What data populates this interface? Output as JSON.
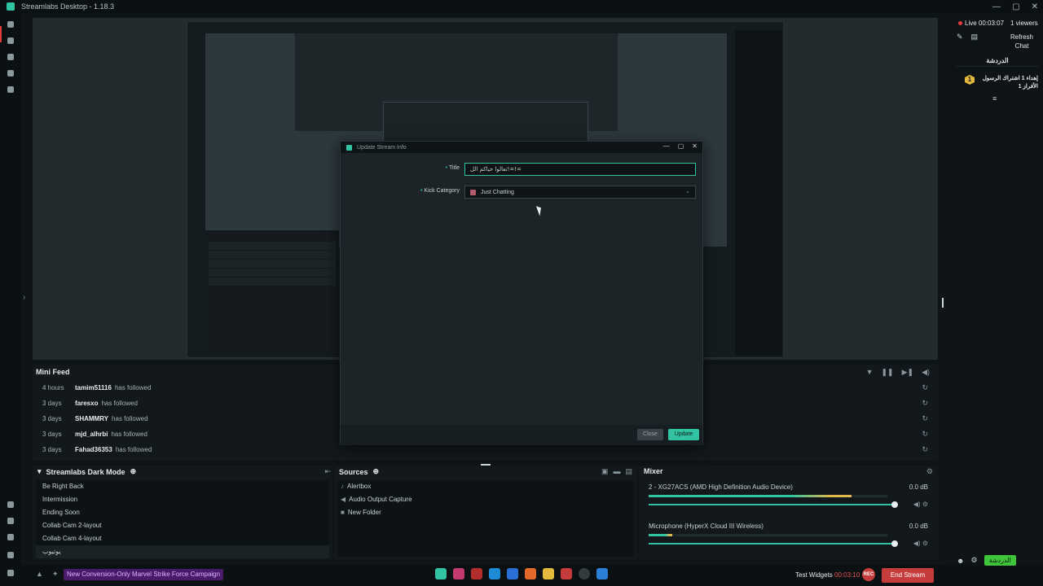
{
  "window": {
    "title": "Streamlabs Desktop - 1.18.3",
    "controls": [
      "—",
      "▢",
      "✕"
    ]
  },
  "minifeed": {
    "title": "Mini Feed",
    "rows": [
      {
        "time": "4 hours",
        "user": "tamim51116",
        "action": "has followed"
      },
      {
        "time": "3 days",
        "user": "faresxo",
        "action": "has followed"
      },
      {
        "time": "3 days",
        "user": "SHAMMRY",
        "action": "has followed"
      },
      {
        "time": "3 days",
        "user": "mjd_alhrbi",
        "action": "has followed"
      },
      {
        "time": "3 days",
        "user": "Fahad36353",
        "action": "has followed"
      }
    ]
  },
  "scenes": {
    "title": "Streamlabs Dark Mode",
    "items": [
      "Be Right Back",
      "Intermission",
      "Ending Soon",
      "Collab Cam 2-layout",
      "Collab Cam 4-layout",
      "يوتيوب"
    ],
    "active_index": 5
  },
  "sources": {
    "title": "Sources",
    "items": [
      {
        "label": "Alertbox",
        "icon": "bell-icon"
      },
      {
        "label": "Audio Output Capture",
        "icon": "speaker-icon"
      },
      {
        "label": "New Folder",
        "icon": "folder-icon"
      }
    ]
  },
  "mixer": {
    "title": "Mixer",
    "channels": [
      {
        "name": "2 - XG27ACS (AMD High Definition Audio Device)",
        "db": "0.0 dB",
        "level": 0.85
      },
      {
        "name": "Microphone (HyperX Cloud III Wireless)",
        "db": "0.0 dB",
        "level": 0.1
      }
    ]
  },
  "footer": {
    "promo": "New Conversion-Only Marvel Strike Force Campaign",
    "test_widgets": "Test Widgets",
    "timer": "00:03:10",
    "rec": "REC",
    "end_stream": "End Stream"
  },
  "chat": {
    "live": "Live 00:03:07",
    "viewers": "1 viewers",
    "refresh": "Refresh Chat",
    "tab": "الدردشة",
    "badge": "1",
    "message": "إهداء 1 اشتراك الرسول الأفراز 1",
    "send": "الدردشة"
  },
  "dialog": {
    "title": "Update Stream Info",
    "title_label": "Title",
    "title_value": "تعالوا حياكم الل!=!=",
    "category_label": "Kick Category",
    "category_value": "Just Chatting",
    "close": "Close",
    "update": "Update"
  }
}
